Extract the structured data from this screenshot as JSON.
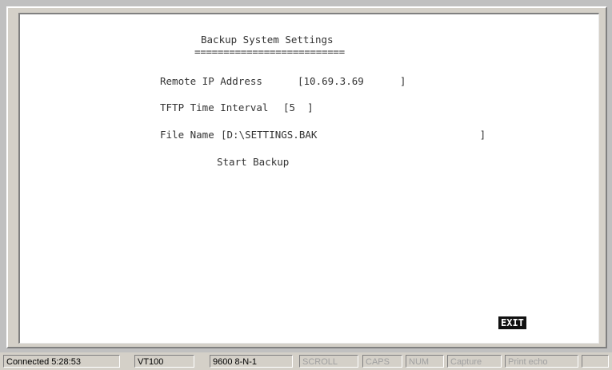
{
  "terminal": {
    "title": "Backup System Settings",
    "title_underline": "==========================",
    "remote_ip": {
      "label": "Remote IP Address",
      "field": "[10.69.3.69      ]"
    },
    "tftp_interval": {
      "label": "TFTP Time Interval",
      "field": "[5  ]"
    },
    "file_name": {
      "label": "File Name",
      "field": "[D:\\SETTINGS.BAK                           ]"
    },
    "start_backup": "Start Backup",
    "exit": "EXIT"
  },
  "statusbar": {
    "connected": "Connected 5:28:53",
    "emulation": "VT100",
    "port_settings": "9600 8-N-1",
    "scroll": "SCROLL",
    "caps": "CAPS",
    "num": "NUM",
    "capture": "Capture",
    "print_echo": "Print echo"
  }
}
